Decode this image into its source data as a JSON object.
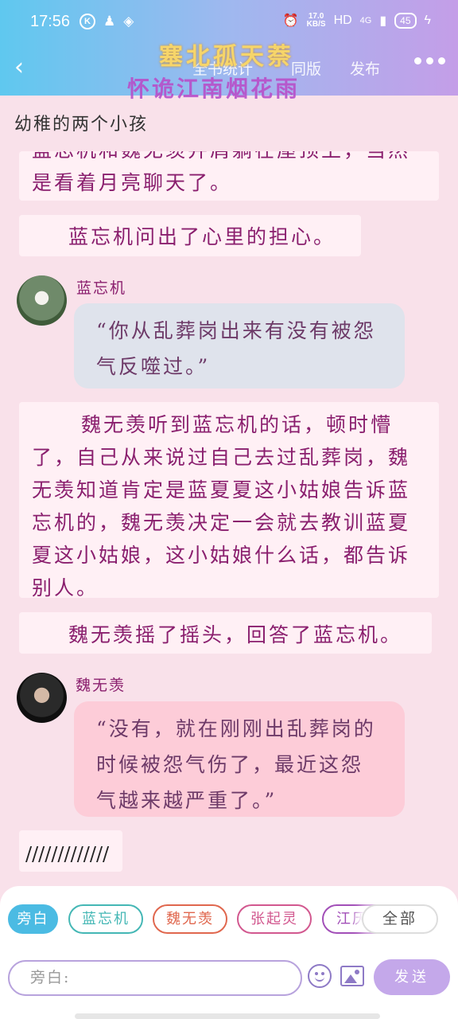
{
  "status_bar": {
    "time": "17:56",
    "speed_value": "17.0",
    "speed_unit": "KB/S",
    "network": "HD",
    "signal": "4G",
    "battery": "45"
  },
  "nav": {
    "tabs": [
      "全书统计",
      "同版",
      "发布"
    ],
    "title_line1": "塞北孤天萘",
    "title_line2": "怀诡江南烟花雨"
  },
  "story": {
    "title": "幼稚的两个小孩",
    "narration_1_partial": "蓝忘机和魏无羡并肩躺在屋顶上，当然是看着月亮聊天了。",
    "narration_2": "蓝忘机问出了心里的担心。",
    "speaker_1": "蓝忘机",
    "dialog_1": "“你从乱葬岗出来有没有被怨气反噬过。”",
    "narration_3": "魏无羡听到蓝忘机的话，顿时懵了，自己从来说过自己去过乱葬岗，魏无羡知道肯定是蓝夏夏这小姑娘告诉蓝忘机的，魏无羡决定一会就去教训蓝夏夏这小姑娘，这小姑娘什么话，都告诉别人。",
    "narration_4": "魏无羡摇了摇头，回答了蓝忘机。",
    "speaker_2": "魏无羡",
    "dialog_2": "“没有，就在刚刚出乱葬岗的时候被怨气伤了，最近这怨气越来越严重了。”",
    "separator": "/////////////"
  },
  "role_chips": [
    {
      "label": "旁白",
      "color": "#4bbbe3"
    },
    {
      "label": "蓝忘机",
      "color": "#44b7b5"
    },
    {
      "label": "魏无羡",
      "color": "#e0674e"
    },
    {
      "label": "张起灵",
      "color": "#d2588f"
    },
    {
      "label": "江厌离",
      "color": "#a24fb8"
    }
  ],
  "all_label": "全部",
  "input": {
    "placeholder": "旁白:"
  },
  "send_label": "发送"
}
